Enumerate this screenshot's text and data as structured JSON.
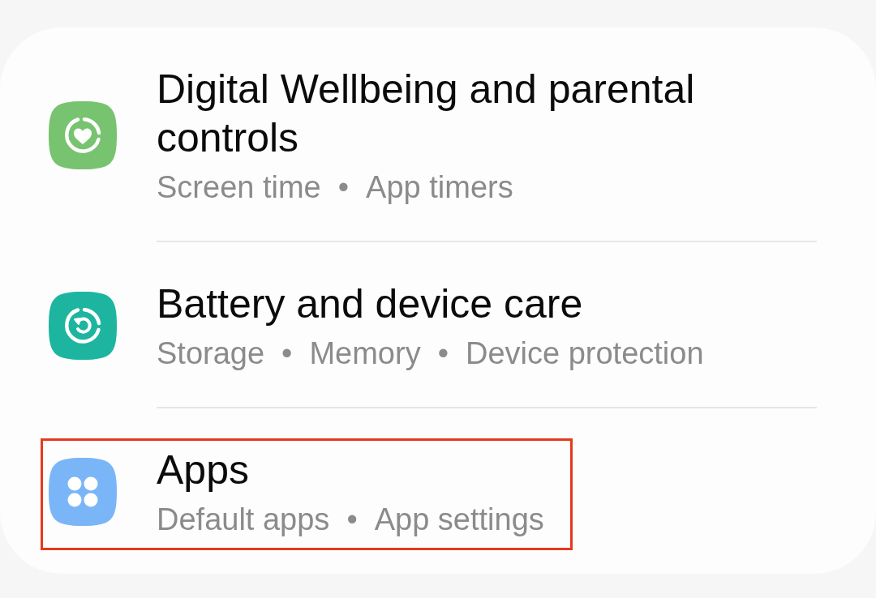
{
  "settings_card": {
    "items": [
      {
        "kind": "wellbeing",
        "color": "#78c36f",
        "title": "Digital Wellbeing and parental controls",
        "summary": [
          "Screen time",
          "•",
          "App timers"
        ],
        "highlighted": false
      },
      {
        "kind": "device_care",
        "color": "#1db5a0",
        "title": "Battery and device care",
        "summary": [
          "Storage",
          "•",
          "Memory",
          "•",
          "Device protection"
        ],
        "highlighted": false
      },
      {
        "kind": "apps",
        "color": "#7ab6f7",
        "title": "Apps",
        "summary": [
          "Default apps",
          "•",
          "App settings"
        ],
        "highlighted": true
      }
    ]
  }
}
